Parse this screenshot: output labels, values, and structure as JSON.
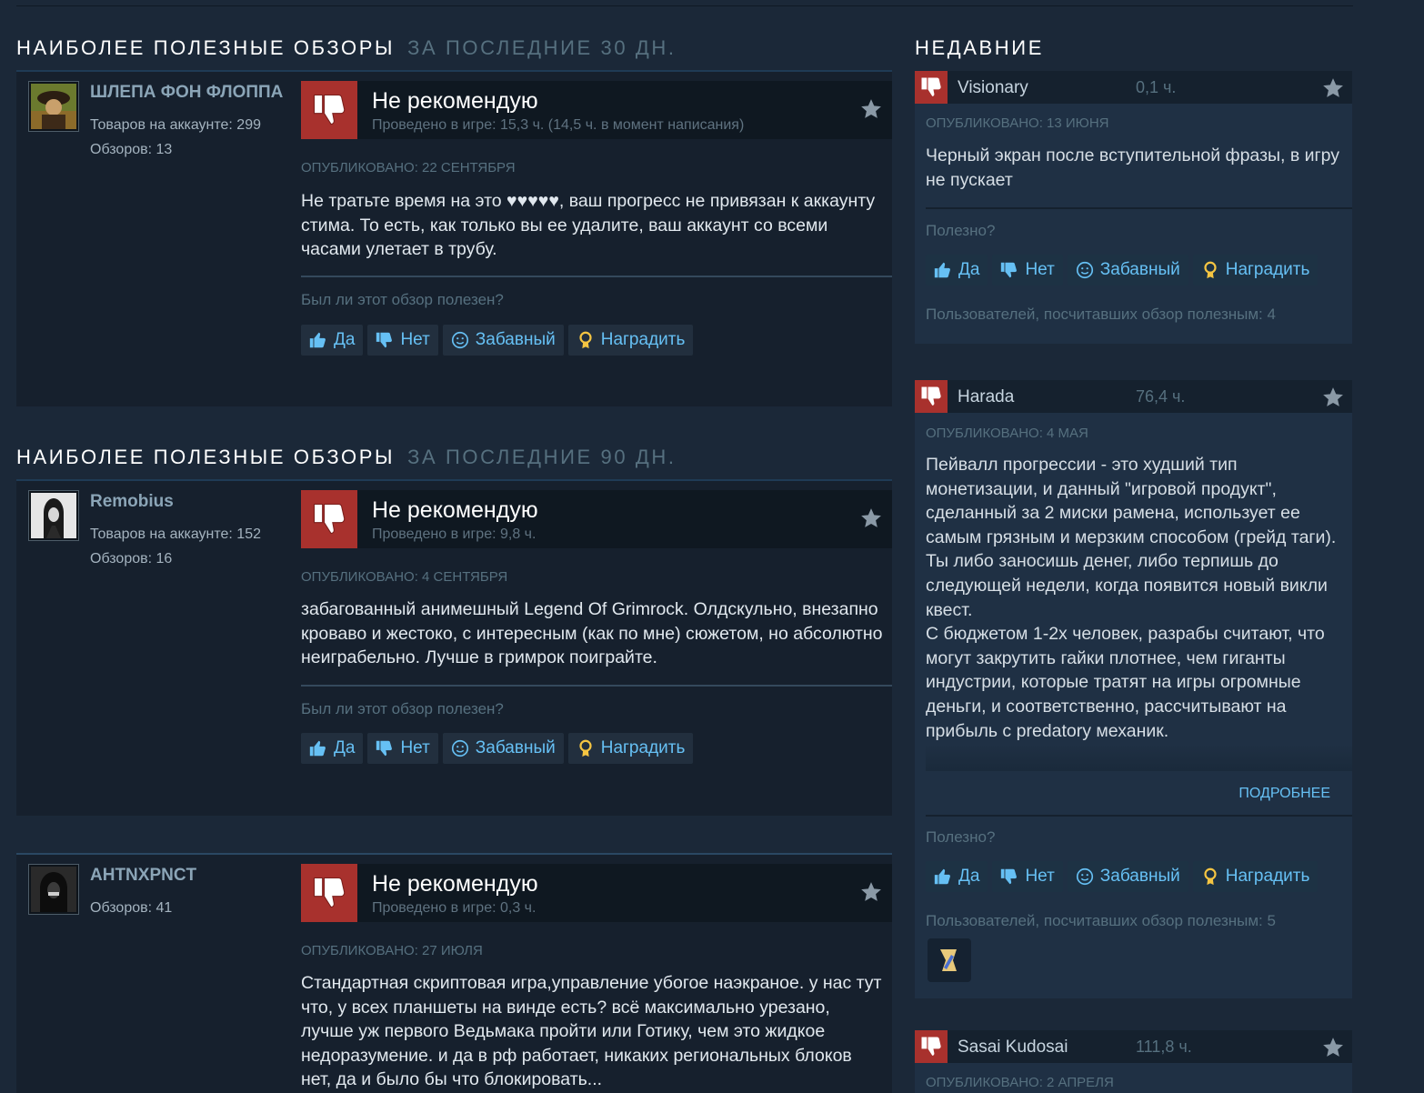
{
  "sections": [
    {
      "title": "Наиболее полезные обзоры",
      "subtitle": "за последние 30 дн."
    },
    {
      "title": "Наиболее полезные обзоры",
      "subtitle": "за последние 90 дн."
    }
  ],
  "reviews": [
    {
      "author": "ШЛЕПА ФОН ФЛОППА",
      "products": "Товаров на аккаунте: 299",
      "reviews_count": "Обзоров: 13",
      "verdict": "Не рекомендую",
      "hours": "Проведено в игре: 15,3 ч. (14,5 ч. в момент написания)",
      "posted": "Опубликовано: 22 сентября",
      "text": "Не тратьте время на это ♥♥♥♥♥, ваш прогресс не привязан к аккаунту стима. То есть, как только вы ее удалите, ваш аккаунт со всеми часами улетает в трубу.",
      "helpful_question": "Был ли этот обзор полезен?"
    },
    {
      "author": "Remobius",
      "products": "Товаров на аккаунте: 152",
      "reviews_count": "Обзоров: 16",
      "verdict": "Не рекомендую",
      "hours": "Проведено в игре: 9,8 ч.",
      "posted": "Опубликовано: 4 сентября",
      "text": "забагованный анимешный Legend Of Grimrock. Олдскульно, внезапно кроваво и жестоко, с интересным (как по мне) сюжетом, но абсолютно неиграбельно. Лучше в гримрок поиграйте.",
      "helpful_question": "Был ли этот обзор полезен?"
    },
    {
      "author": "AHTNXPNCT",
      "reviews_count": "Обзоров: 41",
      "verdict": "Не рекомендую",
      "hours": "Проведено в игре: 0,3 ч.",
      "posted": "Опубликовано: 27 июля",
      "text": "Стандартная скриптовая игра,управление убогое наэкраное. у нас тут что, у всех планшеты на винде есть? всё максимально урезано, лучше уж первого Ведьмака пройти или Готику, чем это жидкое недоразумение. и да в рф работает, никаких региональных блоков нет, да и было бы что блокировать..."
    }
  ],
  "buttons": {
    "yes": "Да",
    "no": "Нет",
    "funny": "Забавный",
    "award": "Наградить"
  },
  "recent": {
    "title": "НЕДАВНИЕ",
    "helpful_q": "Полезно?",
    "more": "Подробнее",
    "items": [
      {
        "name": "Visionary",
        "hours": "0,1 ч.",
        "posted": "Опубликовано: 13 июня",
        "text": "Черный экран после вступительной фразы, в игру не пускает",
        "count": "Пользователей, посчитавших обзор полезным: 4"
      },
      {
        "name": "Harada",
        "hours": "76,4 ч.",
        "posted": "Опубликовано: 4 мая",
        "text": "Пейвалл прогрессии - это худший тип монетизации, и данный \"игровой продукт\", сделанный за 2 миски рамена, использует ее самым грязным и мерзким способом (грейд таги). Ты либо заносишь денег, либо терпишь до следующей недели, когда появится новый викли квест.\nС бюджетом 1-2х человек, разрабы считают, что могут закрутить гайки плотнее, чем гиганты индустрии, которые тратят на игры огромные деньги, и соответственно, рассчитывают на прибыль с predatory механик.",
        "count": "Пользователей, посчитавших обзор полезным: 5"
      },
      {
        "name": "Sasai Kudosai",
        "hours": "111,8 ч.",
        "posted": "Опубликовано: 2 апреля"
      }
    ]
  },
  "colors": {
    "accent": "#66c0f4",
    "thumb_down": "#a8312d",
    "background": "#1b2838"
  }
}
